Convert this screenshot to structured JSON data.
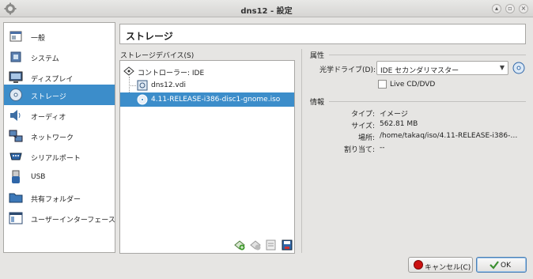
{
  "window": {
    "title": "dns12 - 設定"
  },
  "sidebar": {
    "items": [
      {
        "label": "一般",
        "icon": "general-icon"
      },
      {
        "label": "システム",
        "icon": "system-chip-icon"
      },
      {
        "label": "ディスプレイ",
        "icon": "display-monitor-icon"
      },
      {
        "label": "ストレージ",
        "icon": "storage-disc-icon",
        "selected": true
      },
      {
        "label": "オーディオ",
        "icon": "speaker-icon"
      },
      {
        "label": "ネットワーク",
        "icon": "network-icon"
      },
      {
        "label": "シリアルポート",
        "icon": "serial-port-icon"
      },
      {
        "label": "USB",
        "icon": "usb-icon"
      },
      {
        "label": "共有フォルダー",
        "icon": "folder-icon"
      },
      {
        "label": "ユーザーインターフェース",
        "icon": "user-interface-icon"
      }
    ]
  },
  "page": {
    "title": "ストレージ"
  },
  "storage": {
    "devices_label": "ストレージデバイス(S)",
    "controller": "コントローラー: IDE",
    "disk": "dns12.vdi",
    "optical": "4.11-RELEASE-i386-disc1-gnome.iso"
  },
  "attributes": {
    "section": "属性",
    "optical_drive_label": "光学ドライブ(D):",
    "optical_drive_value": "IDE セカンダリマスター",
    "live_cd_label": "Live CD/DVD",
    "live_cd_checked": false
  },
  "information": {
    "section": "情報",
    "type_label": "タイプ:",
    "type_value": "イメージ",
    "size_label": "サイズ:",
    "size_value": "562.81 MB",
    "location_label": "場所:",
    "location_value": "/home/takaq/iso/4.11-RELEASE-i386-…",
    "attached_label": "割り当て:",
    "attached_value": "--"
  },
  "buttons": {
    "cancel": "キャンセル(C)",
    "ok": "OK"
  },
  "colors": {
    "selection": "#3c8dca",
    "cancel_icon": "#cc1111",
    "ok_check": "#3a8f2f"
  }
}
